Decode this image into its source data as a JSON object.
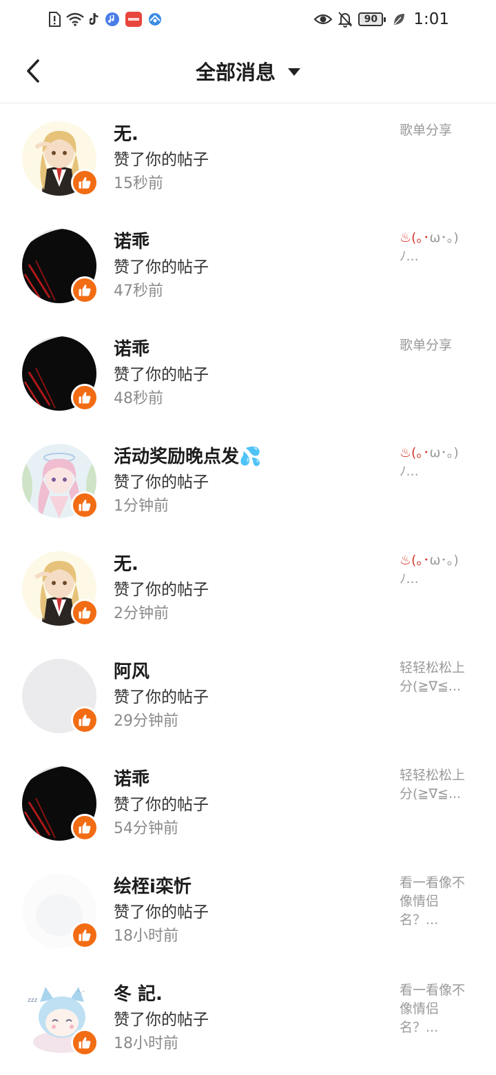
{
  "status_bar": {
    "time": "1:01",
    "battery": "90",
    "left_icons": [
      "sim-alert-icon",
      "wifi-icon",
      "tiktok-icon",
      "music-icon",
      "huawei-app-icon",
      "browser-icon"
    ],
    "right_icons": [
      "eye-icon",
      "bell-off-icon",
      "battery-icon",
      "leaf-icon"
    ]
  },
  "header": {
    "title": "全部消息"
  },
  "items": [
    {
      "name": "无.",
      "action": "赞了你的帖子",
      "time": "15秒前",
      "preview": "歌单分享",
      "avatar": "blonde"
    },
    {
      "name": "诺乖",
      "action": "赞了你的帖子",
      "time": "47秒前",
      "preview": "♨(｡･ω･｡)ﾉ...",
      "avatar": "dark"
    },
    {
      "name": "诺乖",
      "action": "赞了你的帖子",
      "time": "48秒前",
      "preview": "歌单分享",
      "avatar": "dark"
    },
    {
      "name": "活动奖励晚点发💦",
      "action": "赞了你的帖子",
      "time": "1分钟前",
      "preview": "♨(｡･ω･｡)ﾉ...",
      "avatar": "pink"
    },
    {
      "name": "无.",
      "action": "赞了你的帖子",
      "time": "2分钟前",
      "preview": "♨(｡･ω･｡)ﾉ...",
      "avatar": "blonde"
    },
    {
      "name": "阿风",
      "action": "赞了你的帖子",
      "time": "29分钟前",
      "preview": "轻轻松松上分(≧∇≦...",
      "avatar": "gray"
    },
    {
      "name": "诺乖",
      "action": "赞了你的帖子",
      "time": "54分钟前",
      "preview": "轻轻松松上分(≧∇≦...",
      "avatar": "dark"
    },
    {
      "name": "绘桎i栾忻",
      "action": "赞了你的帖子",
      "time": "18小时前",
      "preview": "看一看像不像情侣名？...",
      "avatar": "white"
    },
    {
      "name": "冬 記.",
      "action": "赞了你的帖子",
      "time": "18小时前",
      "preview": "看一看像不像情侣名？...",
      "avatar": "cat"
    }
  ],
  "colors": {
    "like_badge": "#f26c14",
    "secondary_text": "#8a8a8a"
  }
}
